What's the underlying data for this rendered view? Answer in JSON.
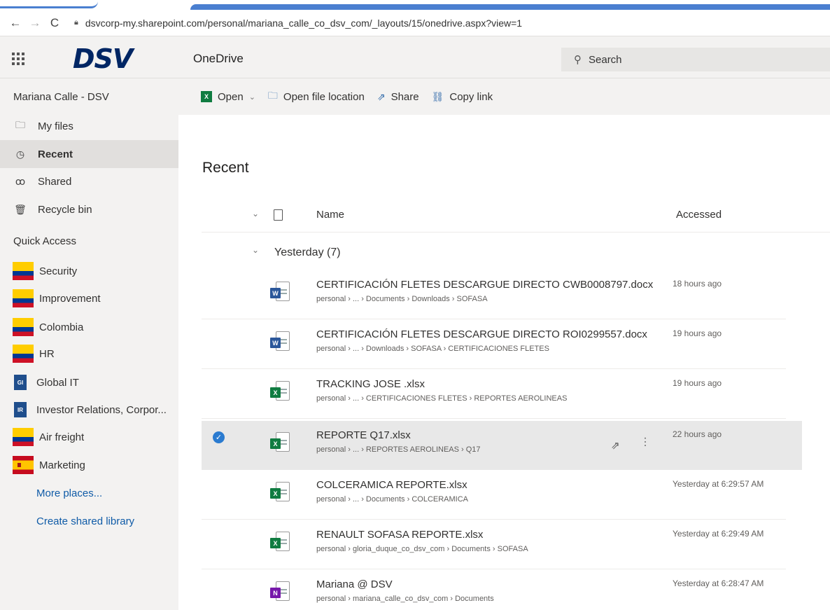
{
  "browser": {
    "url": "dsvcorp-my.sharepoint.com/personal/mariana_calle_co_dsv_com/_layouts/15/onedrive.aspx?view=1",
    "back_glyph": "←",
    "forward_glyph": "→",
    "reload_glyph": "C"
  },
  "header": {
    "logo": "DSV",
    "app_name": "OneDrive",
    "search_placeholder": "Search"
  },
  "sidebar": {
    "user": "Mariana Calle - DSV",
    "nav": [
      {
        "label": "My files",
        "icon": "folder-icon"
      },
      {
        "label": "Recent",
        "icon": "clock-icon",
        "selected": true
      },
      {
        "label": "Shared",
        "icon": "people-icon"
      },
      {
        "label": "Recycle bin",
        "icon": "trash-icon"
      }
    ],
    "quick_access_title": "Quick Access",
    "quick_access": [
      {
        "label": "Security",
        "icon": "colombia-flag-icon"
      },
      {
        "label": "Improvement",
        "icon": "colombia-flag-icon"
      },
      {
        "label": "Colombia",
        "icon": "colombia-flag-icon"
      },
      {
        "label": "HR",
        "icon": "colombia-flag-icon"
      },
      {
        "label": "Global IT",
        "icon": "site-tile-icon",
        "tile_text": "GI",
        "tile_color": "#1f4e8c"
      },
      {
        "label": "Investor Relations, Corpor...",
        "icon": "site-tile-icon",
        "tile_text": "IR",
        "tile_color": "#1f4e8c"
      },
      {
        "label": "Air freight",
        "icon": "colombia-flag-icon"
      },
      {
        "label": "Marketing",
        "icon": "spain-flag-icon"
      }
    ],
    "more_places": "More places...",
    "create_library": "Create shared library"
  },
  "commands": {
    "open": "Open",
    "open_location": "Open file location",
    "share": "Share",
    "copy_link": "Copy link"
  },
  "main": {
    "title": "Recent",
    "col_name": "Name",
    "col_accessed": "Accessed",
    "group_label": "Yesterday (7)",
    "files": [
      {
        "name": "CERTIFICACIÓN FLETES DESCARGUE DIRECTO CWB0008797.docx",
        "path": "personal › ... › Documents › Downloads › SOFASA",
        "accessed": "18 hours ago",
        "type": "word",
        "badge": "W"
      },
      {
        "name": "CERTIFICACIÓN FLETES DESCARGUE DIRECTO ROI0299557.docx",
        "path": "personal › ... › Downloads › SOFASA › CERTIFICACIONES FLETES",
        "accessed": "19 hours ago",
        "type": "word",
        "badge": "W"
      },
      {
        "name": "TRACKING JOSE .xlsx",
        "path": "personal › ... › CERTIFICACIONES FLETES › REPORTES AEROLINEAS",
        "accessed": "19 hours ago",
        "type": "excel",
        "badge": "X"
      },
      {
        "name": "REPORTE Q17.xlsx",
        "path": "personal › ... › REPORTES AEROLINEAS › Q17",
        "accessed": "22 hours ago",
        "type": "excel",
        "badge": "X",
        "selected": true
      },
      {
        "name": "COLCERAMICA REPORTE.xlsx",
        "path": "personal › ... › Documents › COLCERAMICA",
        "accessed": "Yesterday at 6:29:57 AM",
        "type": "excel",
        "badge": "X"
      },
      {
        "name": "RENAULT SOFASA REPORTE.xlsx",
        "path": "personal › gloria_duque_co_dsv_com › Documents › SOFASA",
        "accessed": "Yesterday at 6:29:49 AM",
        "type": "excel",
        "badge": "X"
      },
      {
        "name": "Mariana @ DSV",
        "path": "personal › mariana_calle_co_dsv_com › Documents",
        "accessed": "Yesterday at 6:28:47 AM",
        "type": "onenote",
        "badge": "N"
      }
    ]
  },
  "colors": {
    "word": "#2b579a",
    "excel": "#107c41",
    "onenote": "#7719aa",
    "accent": "#2b7bd0",
    "link": "#0f5ba7"
  }
}
